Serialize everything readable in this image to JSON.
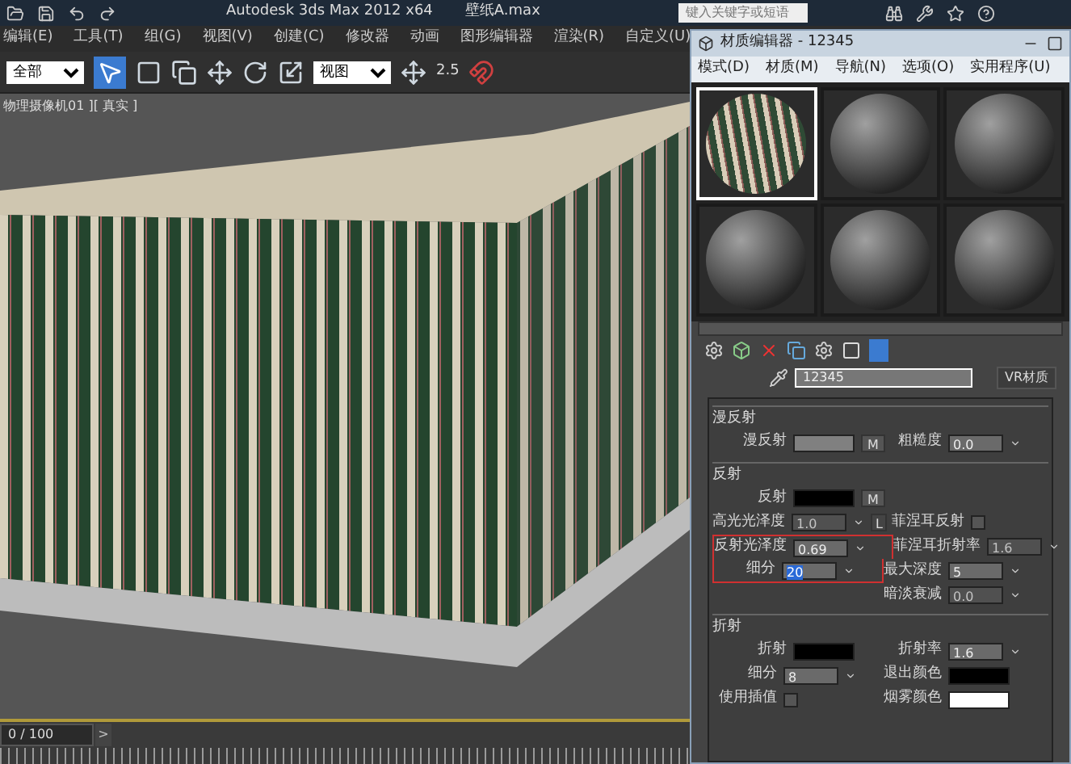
{
  "app_title": "Autodesk 3ds Max  2012 x64",
  "file_name": "壁纸A.max",
  "search": {
    "placeholder": "键入关键字或短语"
  },
  "menu": [
    "编辑(E)",
    "工具(T)",
    "组(G)",
    "视图(V)",
    "创建(C)",
    "修改器",
    "动画",
    "图形编辑器",
    "渲染(R)",
    "自定义(U)"
  ],
  "toolbar": {
    "selection_filter": "全部",
    "coord_system": "视图",
    "snap_label": "2.5"
  },
  "viewport_label": "物理摄像机01 ][ 真实 ]",
  "timeline": {
    "frame": "0 / 100",
    "next": ">"
  },
  "material_editor": {
    "title": "材质编辑器 - 12345",
    "menu": [
      "模式(D)",
      "材质(M)",
      "导航(N)",
      "选项(O)",
      "实用程序(U)"
    ],
    "slots": [
      {
        "selected": true
      },
      {
        "selected": false
      },
      {
        "selected": false
      },
      {
        "selected": false
      },
      {
        "selected": false
      },
      {
        "selected": false
      }
    ],
    "material_name": "12345",
    "material_type": "VR材质",
    "sections": [
      {
        "title": "漫反射",
        "rows": [
          {
            "boxed": false,
            "left": {
              "label": "漫反射",
              "kind": "swatch",
              "color": "#808080",
              "map": "M"
            },
            "right": {
              "label": "粗糙度",
              "kind": "spinner",
              "value": "0.0",
              "disabled": false
            }
          }
        ]
      },
      {
        "title": "反射",
        "rows": [
          {
            "boxed": false,
            "left": {
              "label": "反射",
              "kind": "swatch",
              "color": "#000000",
              "map": "M"
            }
          },
          {
            "boxed": false,
            "left": {
              "label": "高光光泽度",
              "kind": "spinner",
              "value": "1.0",
              "disabled": true,
              "lock": "L"
            },
            "right": {
              "label": "菲涅耳反射",
              "kind": "checkbox",
              "checked": false
            }
          },
          {
            "boxed": true,
            "left": {
              "label": "反射光泽度",
              "kind": "spinner",
              "value": "0.69",
              "disabled": false
            },
            "right": {
              "label": "菲涅耳折射率",
              "kind": "spinner",
              "value": "1.6",
              "disabled": true
            }
          },
          {
            "boxed": true,
            "left": {
              "label": "细分",
              "kind": "spinner",
              "value": "20",
              "disabled": false,
              "selected": true
            },
            "right": {
              "label": "最大深度",
              "kind": "spinner",
              "value": "5",
              "disabled": false
            }
          },
          {
            "boxed": false,
            "right": {
              "label": "暗淡衰减",
              "kind": "spinner",
              "value": "0.0",
              "disabled": true
            }
          }
        ]
      },
      {
        "title": "折射",
        "rows": [
          {
            "boxed": false,
            "left": {
              "label": "折射",
              "kind": "swatch",
              "color": "#000000"
            },
            "right": {
              "label": "折射率",
              "kind": "spinner",
              "value": "1.6",
              "disabled": false
            }
          },
          {
            "boxed": false,
            "left": {
              "label": "细分",
              "kind": "spinner",
              "value": "8",
              "disabled": false
            },
            "right": {
              "label": "退出颜色",
              "kind": "swatch",
              "color": "#000000"
            }
          },
          {
            "boxed": false,
            "left": {
              "label": "使用插值",
              "kind": "checkbox",
              "checked": false
            },
            "right": {
              "label": "烟雾颜色",
              "kind": "swatch",
              "color": "#ffffff"
            }
          }
        ]
      }
    ]
  }
}
